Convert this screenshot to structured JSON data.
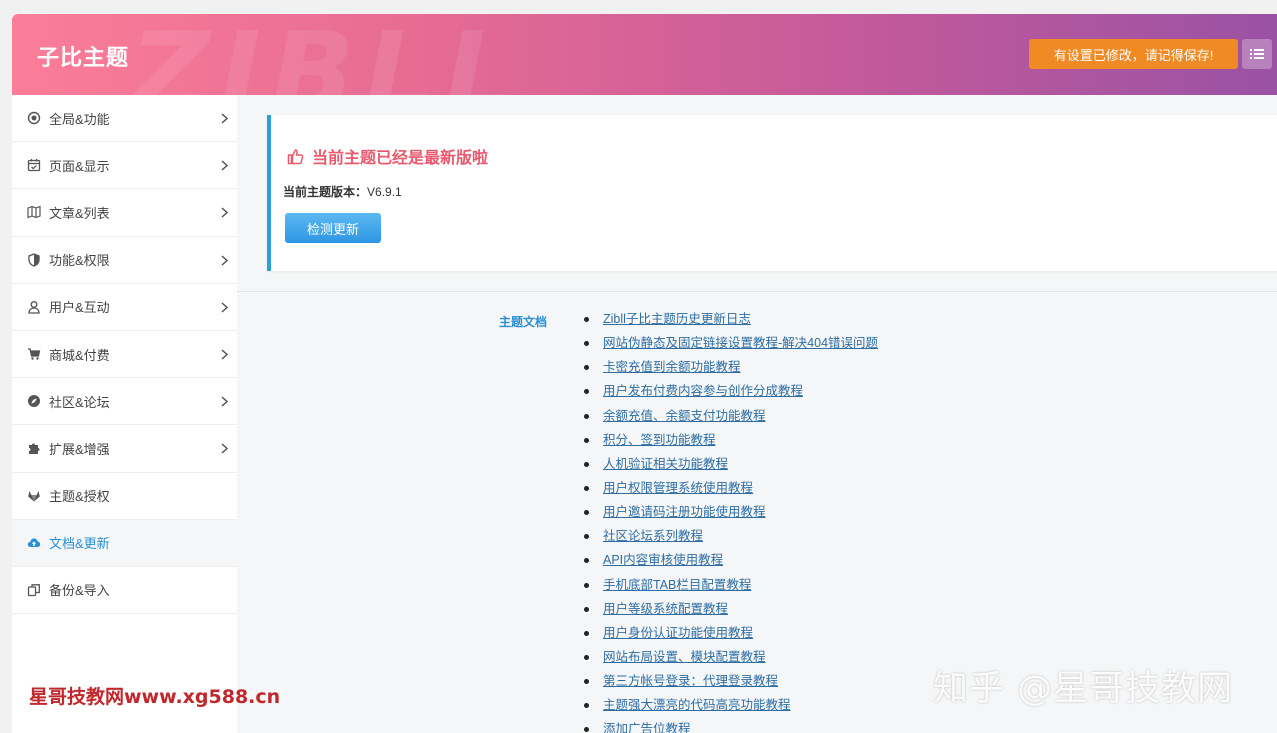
{
  "header": {
    "brand": "子比主题",
    "watermark": "ZIBLL",
    "save_notice": "有设置已修改，请记得保存!",
    "menu_icon": "list-icon"
  },
  "sidebar": {
    "items": [
      {
        "label": "全局&功能",
        "icon": "target-icon",
        "has_arrow": true
      },
      {
        "label": "页面&显示",
        "icon": "calendar-icon",
        "has_arrow": true
      },
      {
        "label": "文章&列表",
        "icon": "map-icon",
        "has_arrow": true
      },
      {
        "label": "功能&权限",
        "icon": "shield-icon",
        "has_arrow": true
      },
      {
        "label": "用户&互动",
        "icon": "user-icon",
        "has_arrow": true
      },
      {
        "label": "商城&付费",
        "icon": "cart-icon",
        "has_arrow": true
      },
      {
        "label": "社区&论坛",
        "icon": "compass-icon",
        "has_arrow": true
      },
      {
        "label": "扩展&增强",
        "icon": "puzzle-icon",
        "has_arrow": true
      },
      {
        "label": "主题&授权",
        "icon": "gitlab-icon",
        "has_arrow": false
      },
      {
        "label": "文档&更新",
        "icon": "cloud-upload-icon",
        "has_arrow": false,
        "active": true
      },
      {
        "label": "备份&导入",
        "icon": "copy-icon",
        "has_arrow": false
      }
    ]
  },
  "update": {
    "title": "当前主题已经是最新版啦",
    "version_label": "当前主题版本：",
    "version": "V6.9.1",
    "check_button": "检测更新"
  },
  "docs": {
    "label": "主题文档",
    "links": [
      "Zibll子比主题历史更新日志",
      "网站伪静态及固定链接设置教程-解决404错误问题",
      "卡密充值到余额功能教程",
      "用户发布付费内容参与创作分成教程",
      "余额充值、余额支付功能教程",
      "积分、签到功能教程",
      "人机验证相关功能教程",
      "用户权限管理系统使用教程",
      "用户邀请码注册功能使用教程",
      "社区论坛系列教程",
      "API内容审核使用教程",
      "手机底部TAB栏目配置教程",
      "用户等级系统配置教程",
      "用户身份认证功能使用教程",
      "网站布局设置、模块配置教程",
      "第三方帐号登录：代理登录教程",
      "主题强大漂亮的代码高亮功能教程",
      "添加广告位教程"
    ]
  },
  "watermarks": {
    "left": "星哥技教网www.xg588.cn",
    "right": "知乎 @星哥技教网"
  },
  "colors": {
    "accent": "#2b8fd6",
    "title_red": "#e85a6e",
    "save_orange": "#f08a24",
    "header_start": "#fb7d98",
    "header_end": "#9a52a4"
  }
}
